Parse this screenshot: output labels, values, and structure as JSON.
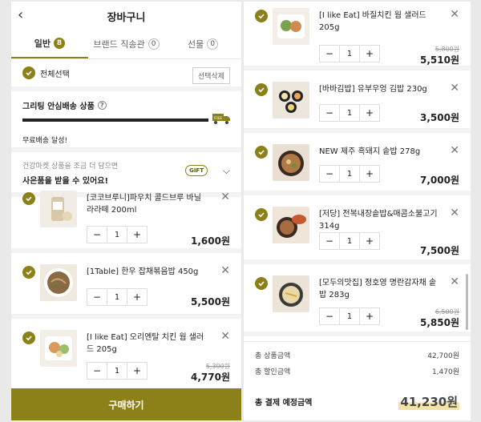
{
  "header": {
    "title": "장바구니"
  },
  "tabs": [
    {
      "label": "일반",
      "count": "8"
    },
    {
      "label": "브랜드 직송관",
      "count": "0"
    },
    {
      "label": "선물",
      "count": "0"
    }
  ],
  "select": {
    "all_label": "전체선택",
    "delete_label": "선택삭제"
  },
  "shipping": {
    "title": "그리팅 안심배송 상품",
    "status": "무료배송 달성!",
    "progress": 1.0,
    "truck_label": "FREE"
  },
  "gift": {
    "sub": "건강마켓 상품을 조금 더 담으면",
    "bold": "사은품을 받을 수 있어요!",
    "badge": "GIFT"
  },
  "left_items": [
    {
      "name": "[코코브루니]파우치 콜드브루 바닐라라떼 200ml",
      "qty": "1",
      "orig": "",
      "price": "1,600원"
    },
    {
      "name": "[1Table] 한우 잡채볶음밥 450g",
      "qty": "1",
      "orig": "",
      "price": "5,500원"
    },
    {
      "name": "[I like Eat] 오리엔탈 치킨 웜 샐러드 205g",
      "qty": "1",
      "orig": "5,300원",
      "price": "4,770원"
    }
  ],
  "right_items": [
    {
      "name": "[I like Eat] 바질치킨 웜 샐러드 205g",
      "qty": "1",
      "orig": "5,800원",
      "price": "5,510원"
    },
    {
      "name": "[바바김밥] 유부우엉 김밥 230g",
      "qty": "1",
      "orig": "",
      "price": "3,500원"
    },
    {
      "name": "NEW 제주 흑돼지 솥밥 278g",
      "qty": "1",
      "orig": "",
      "price": "7,000원"
    },
    {
      "name": "[저당] 전복내장솥밥&매콤소불고기 314g",
      "qty": "1",
      "orig": "",
      "price": "7,500원"
    },
    {
      "name": "[모두의맛집] 정호영 명란감자채 솥밥 283g",
      "qty": "1",
      "orig": "6,500원",
      "price": "5,850원"
    }
  ],
  "summary": {
    "goods_label": "총 상품금액",
    "goods_value": "42,700원",
    "discount_label": "총 할인금액",
    "discount_value": "1,470원",
    "total_label": "총 결제 예정금액",
    "total_value": "41,230원"
  },
  "buy_label": "구매하기",
  "colors": {
    "accent": "#8c8018"
  }
}
